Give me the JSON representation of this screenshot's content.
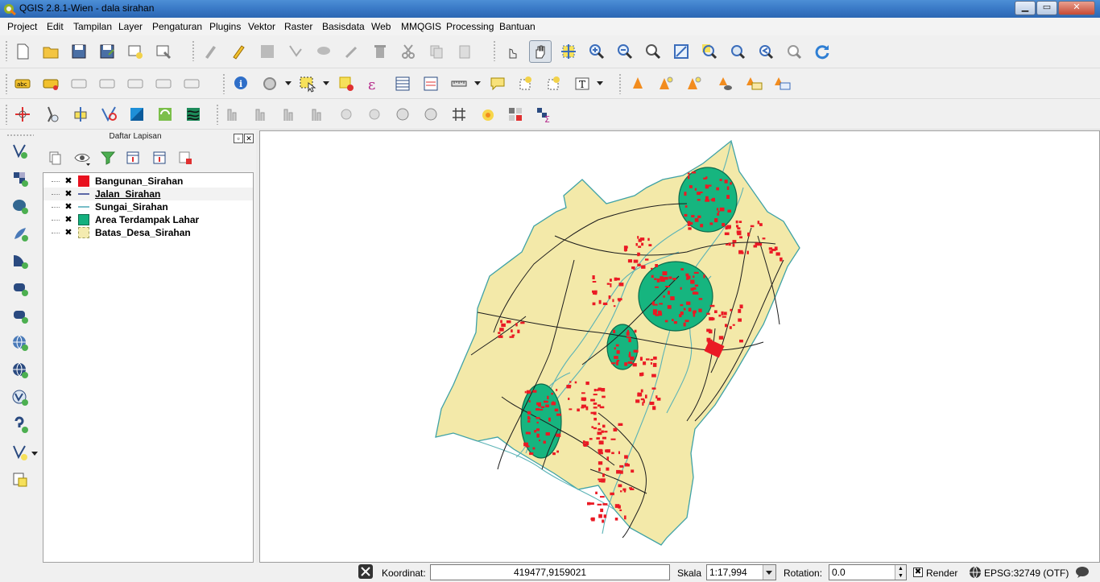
{
  "window": {
    "title": "QGIS 2.8.1-Wien - dala sirahan",
    "min_label": "▁",
    "max_label": "▭",
    "close_label": "✕"
  },
  "menu": [
    "Project",
    "Edit",
    "Tampilan",
    "Layer",
    "Pengaturan",
    "Plugins",
    "Vektor",
    "Raster",
    "Basisdata",
    "Web",
    "MMQGIS",
    "Processing",
    "Bantuan"
  ],
  "layers_panel": {
    "title": "Daftar Lapisan",
    "layers": [
      {
        "name": "Bangunan_Sirahan",
        "checked": "✖",
        "symbol": "fill",
        "color": "#e8101e",
        "selected": false
      },
      {
        "name": "Jalan_Sirahan",
        "checked": "✖",
        "symbol": "line",
        "color": "#2b3a8c",
        "selected": true
      },
      {
        "name": "Sungai_Sirahan",
        "checked": "✖",
        "symbol": "line",
        "color": "#4aa8b6",
        "selected": false
      },
      {
        "name": "Area Terdampak Lahar",
        "checked": "✖",
        "symbol": "fill",
        "color": "#13b07e",
        "selected": false
      },
      {
        "name": "Batas_Desa_Sirahan",
        "checked": "✖",
        "symbol": "fill",
        "color": "#f4ebb0",
        "selected": false
      }
    ]
  },
  "map": {
    "colors": {
      "village": "#f3e9a9",
      "impact": "#16b57f",
      "building": "#ea1a24",
      "road": "#1c1c1c",
      "river": "#5bb3b6",
      "boundary": "#3fa2a6"
    }
  },
  "status": {
    "coord_label": "Koordinat:",
    "coord_value": "419477,9159021",
    "scale_label": "Skala",
    "scale_value": "1:17,994",
    "rotation_label": "Rotation:",
    "rotation_value": "0.0",
    "render_label": "Render",
    "render_checked": "✖",
    "crs_label": "EPSG:32749 (OTF)"
  }
}
